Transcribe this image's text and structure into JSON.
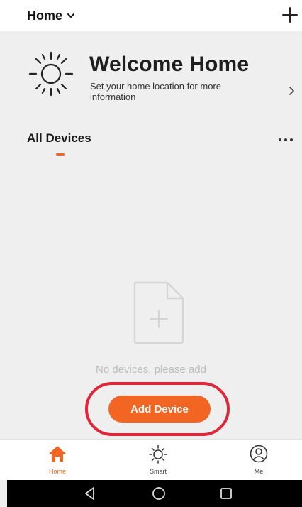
{
  "header": {
    "home_label": "Home",
    "home_dropdown_icon": "chevron-down-icon",
    "add_icon": "plus-icon"
  },
  "welcome": {
    "icon": "sun-icon",
    "title": "Welcome Home",
    "subtitle": "Set your home location for more information",
    "arrow_icon": "chevron-right-icon"
  },
  "devices": {
    "tab_label": "All Devices",
    "more_icon": "more-dots-icon",
    "empty_icon": "add-file-icon",
    "empty_text": "No devices, please add",
    "add_button_label": "Add Device"
  },
  "bottom_nav": {
    "items": [
      {
        "label": "Home",
        "icon": "home-icon",
        "active": true
      },
      {
        "label": "Smart",
        "icon": "smart-sun-icon",
        "active": false
      },
      {
        "label": "Me",
        "icon": "user-icon",
        "active": false
      }
    ]
  },
  "system_nav": {
    "items": [
      {
        "icon": "back-icon"
      },
      {
        "icon": "home-circle-icon"
      },
      {
        "icon": "recents-icon"
      }
    ]
  },
  "colors": {
    "accent": "#f26522",
    "highlight": "#e0263a",
    "background": "#efefef"
  }
}
